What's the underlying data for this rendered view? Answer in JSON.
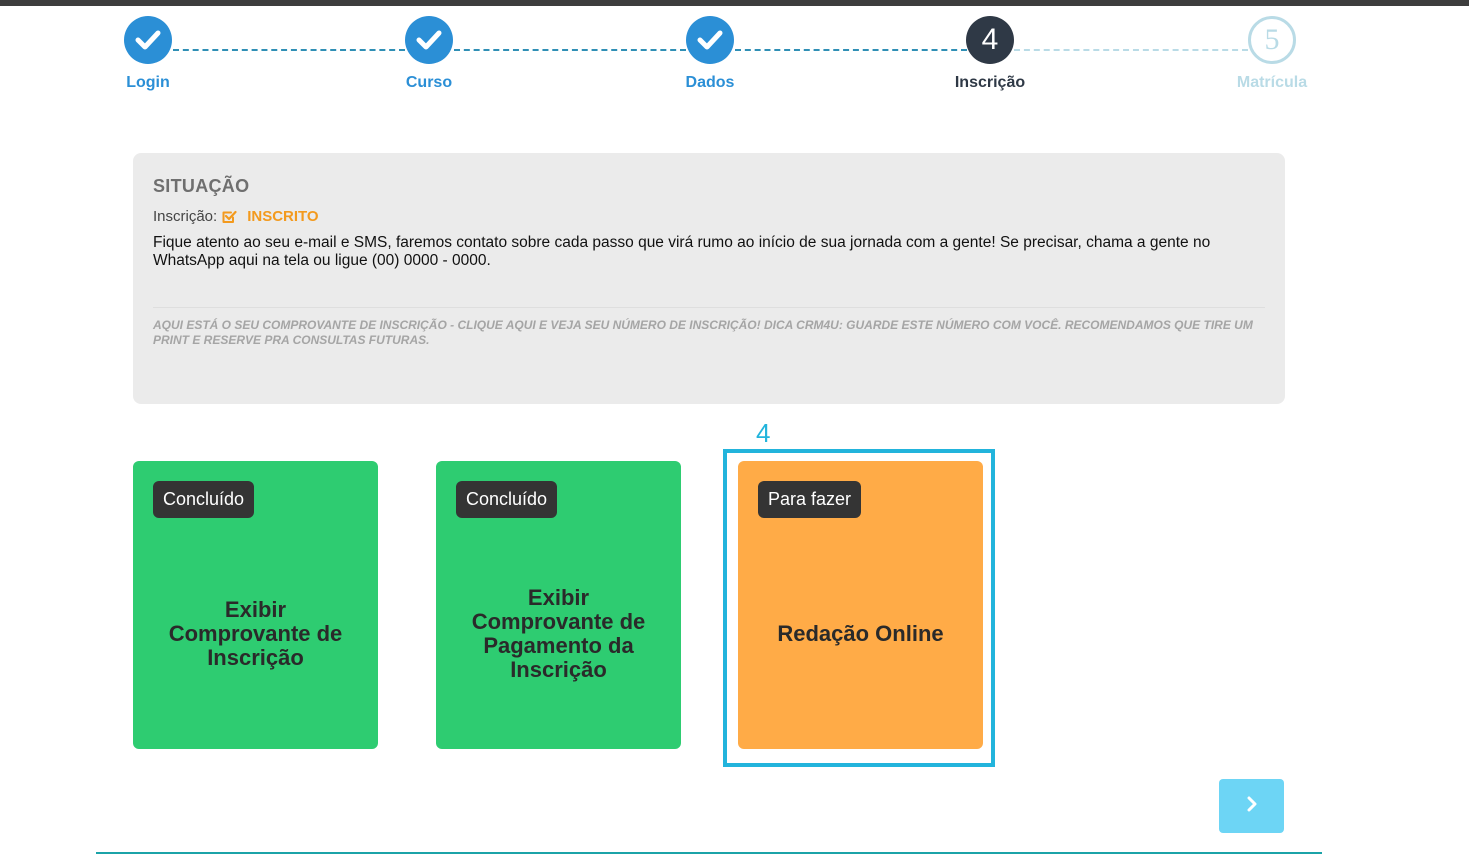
{
  "stepper": {
    "steps": [
      {
        "label": "Login",
        "state": "done",
        "number": ""
      },
      {
        "label": "Curso",
        "state": "done",
        "number": ""
      },
      {
        "label": "Dados",
        "state": "done",
        "number": ""
      },
      {
        "label": "Inscrição",
        "state": "current",
        "number": "4"
      },
      {
        "label": "Matrícula",
        "state": "future",
        "number": "5"
      }
    ],
    "icons": {
      "done": "checkmark-icon"
    }
  },
  "status_panel": {
    "title": "SITUAÇÃO",
    "status_label": "Inscrição:",
    "status_icon": "checkbox-checked-icon",
    "status_value": "INSCRITO",
    "message": "Fique atento ao seu e-mail e SMS, faremos contato sobre cada passo que virá rumo ao início de sua jornada com a gente! Se precisar, chama a gente no WhatsApp aqui na tela ou ligue (00) 0000 - 0000.",
    "note": "Aqui está o seu comprovante de inscrição - clique aqui e veja seu número de inscrição! Dica CRM4U: Guarde este número com você. Recomendamos que tire um print e reserve pra consultas futuras."
  },
  "cards": [
    {
      "badge": "Concluído",
      "title": "Exibir Comprovante de Inscrição",
      "color": "#2ecc71"
    },
    {
      "badge": "Concluído",
      "title": "Exibir Comprovante de Pagamento da Inscrição",
      "color": "#2ecc71"
    },
    {
      "badge": "Para fazer",
      "title": "Redação Online",
      "color": "#ffab47"
    }
  ],
  "highlight": {
    "number": "4",
    "color": "#22b4dc"
  },
  "next_button": {
    "icon": "chevron-right-icon",
    "color": "#6dd5f5"
  },
  "colors": {
    "primary": "#2b8fd6",
    "current": "#2f3946",
    "muted": "#b9dbe6",
    "warning": "#f39a1e"
  }
}
